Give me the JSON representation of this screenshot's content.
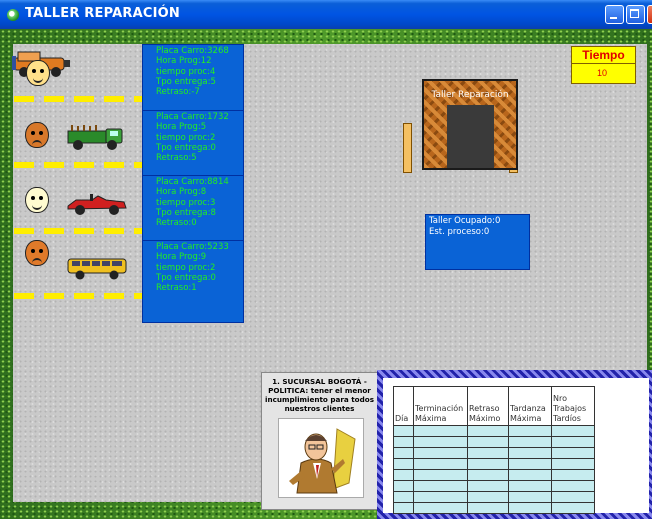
{
  "window": {
    "title": "TALLER REPARACIÓN",
    "controls": [
      "minimize",
      "maximize",
      "close"
    ]
  },
  "colors": {
    "road": "#c9c9c9",
    "infobox_bg": "#0a63d6",
    "infobox_text": "#22ee22",
    "lane_marker": "#ffee00",
    "timer_bg": "#ffff00",
    "timer_text": "#e00000",
    "table_cell": "#c6ecef"
  },
  "queue": [
    {
      "face": "happy",
      "car": "orange-jeep",
      "lines": [
        "Placa Carro:3268",
        "Hora Prog:12",
        "tiempo proc:4",
        "Tpo entrega:5",
        "Retraso:-7"
      ]
    },
    {
      "face": "sad",
      "car": "green-truck",
      "lines": [
        "Placa Carro:1732",
        "Hora Prog:5",
        "tiempo proc:2",
        "Tpo entrega:0",
        "Retraso:5"
      ]
    },
    {
      "face": "happy",
      "car": "red-convertible",
      "lines": [
        "Placa Carro:8814",
        "Hora Prog:8",
        "tiempo proc:3",
        "Tpo entrega:8",
        "Retraso:0"
      ]
    },
    {
      "face": "sad",
      "car": "yellow-bus",
      "lines": [
        "Placa Carro:5233",
        "Hora Prog:9",
        "tiempo proc:2",
        "Tpo entrega:0",
        "Retraso:1"
      ]
    }
  ],
  "timer": {
    "label": "Tiempo",
    "value": "10"
  },
  "workshop": {
    "label": "Taller Reparación"
  },
  "status": {
    "lines": [
      "Taller Ocupado:0",
      "Est. proceso:0"
    ]
  },
  "policy": {
    "text": "1. SUCURSAL BOGOTÁ - POLITICA: tener el menor incumplimiento para todos nuestros clientes",
    "image": "businessman-icon"
  },
  "results_table": {
    "headers": [
      "Día",
      "Terminación Máxima",
      "Retraso Máximo",
      "Tardanza Máxima",
      "Nro Trabajos Tardíos"
    ],
    "rows": [
      [
        "",
        "",
        "",
        "",
        ""
      ],
      [
        "",
        "",
        "",
        "",
        ""
      ],
      [
        "",
        "",
        "",
        "",
        ""
      ],
      [
        "",
        "",
        "",
        "",
        ""
      ],
      [
        "",
        "",
        "",
        "",
        ""
      ],
      [
        "",
        "",
        "",
        "",
        ""
      ],
      [
        "",
        "",
        "",
        "",
        ""
      ],
      [
        "",
        "",
        "",
        "",
        ""
      ]
    ]
  }
}
